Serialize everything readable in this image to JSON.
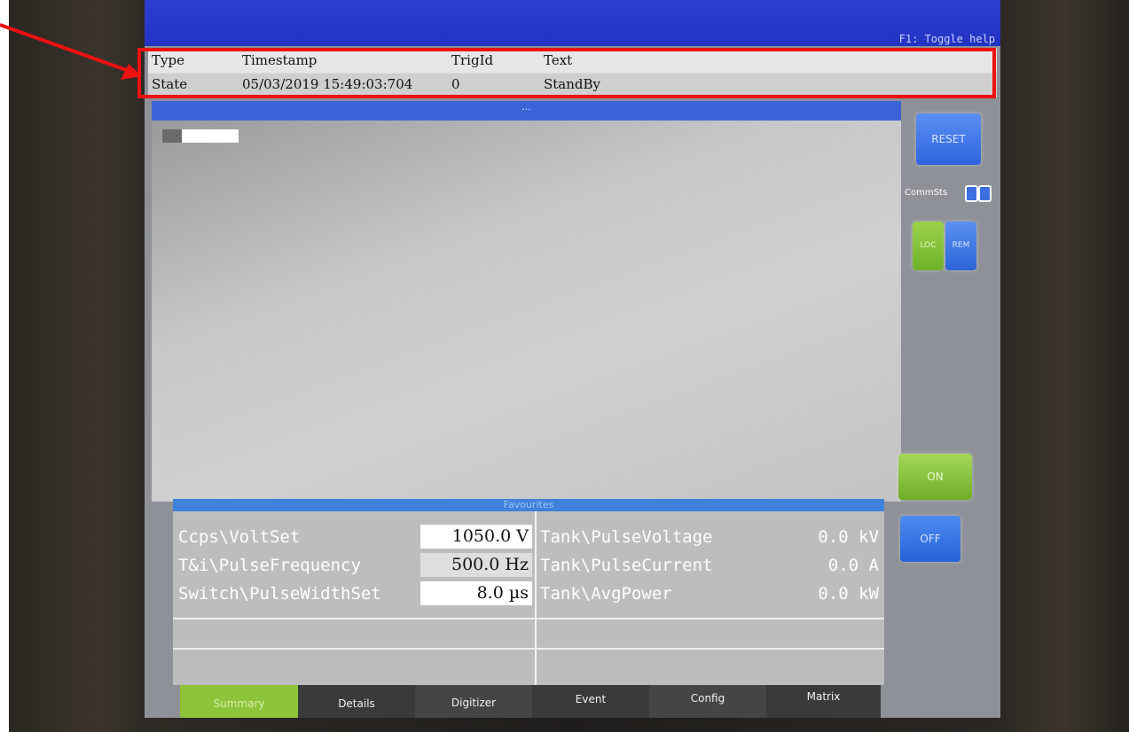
{
  "help_hint": "F1: Toggle help",
  "event_log": {
    "headers": [
      "Type",
      "Timestamp",
      "TrigId",
      "Text"
    ],
    "row": [
      "State",
      "05/03/2019 15:49:03:704",
      "0",
      "StandBy"
    ]
  },
  "video_title": "...",
  "favourites": {
    "title": "Favourites",
    "left": [
      {
        "label": "Ccps\\VoltSet",
        "value": "1050.0 V"
      },
      {
        "label": "T&i\\PulseFrequency",
        "value": "500.0 Hz"
      },
      {
        "label": "Switch\\PulseWidthSet",
        "value": "8.0 µs"
      }
    ],
    "right": [
      {
        "label": "Tank\\PulseVoltage",
        "value": "0.0 kV"
      },
      {
        "label": "Tank\\PulseCurrent",
        "value": "0.0 A"
      },
      {
        "label": "Tank\\AvgPower",
        "value": "0.0 kW"
      }
    ]
  },
  "tabs": [
    "Summary",
    "Details",
    "Digitizer",
    "Event",
    "Config",
    "Matrix"
  ],
  "active_tab": "Summary",
  "controls": {
    "reset": "RESET",
    "commsts": "CommSts",
    "loc": "LOC",
    "rem": "REM",
    "on": "ON",
    "off": "OFF"
  },
  "colors": {
    "topbar": "#2233c4",
    "highlight": "#ee1111",
    "active_tab": "#8dc43a",
    "button_blue": "#2f64df",
    "button_green": "#6fb22b"
  }
}
